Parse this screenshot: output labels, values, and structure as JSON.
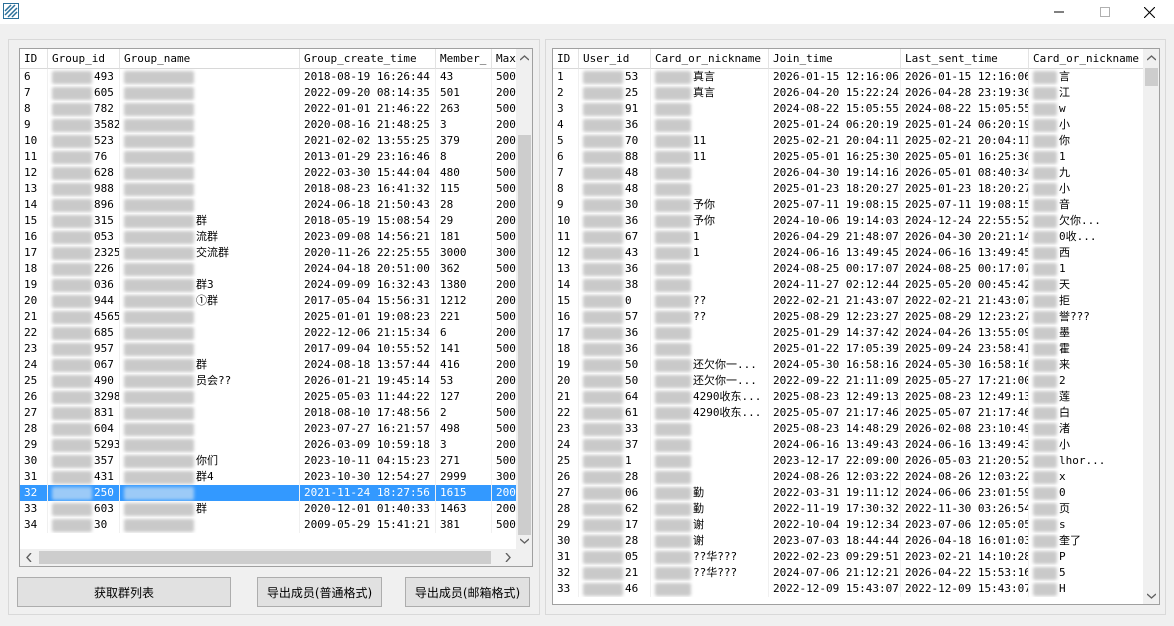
{
  "window": {
    "controls": [
      "minimize-icon",
      "maximize-icon",
      "close-icon"
    ]
  },
  "left_table": {
    "columns": [
      "ID",
      "Group_id",
      "Group_name",
      "Group_create_time",
      "Member_",
      "Max"
    ],
    "rows": [
      {
        "id": "6",
        "gid": "493",
        "name": "",
        "time": "2018-08-19 16:26:44",
        "member": "43",
        "max": "500"
      },
      {
        "id": "7",
        "gid": "605",
        "name": "",
        "time": "2022-09-20 08:14:35",
        "member": "501",
        "max": "200"
      },
      {
        "id": "8",
        "gid": "782",
        "name": "",
        "time": "2022-01-01 21:46:22",
        "member": "263",
        "max": "500"
      },
      {
        "id": "9",
        "gid": "3582",
        "name": "",
        "time": "2020-08-16 21:48:25",
        "member": "3",
        "max": "200"
      },
      {
        "id": "10",
        "gid": "523",
        "name": "",
        "time": "2021-02-02 13:55:25",
        "member": "379",
        "max": "200"
      },
      {
        "id": "11",
        "gid": "76",
        "name": "",
        "time": "2013-01-29 23:16:46",
        "member": "8",
        "max": "200"
      },
      {
        "id": "12",
        "gid": "628",
        "name": "",
        "time": "2022-03-30 15:44:04",
        "member": "480",
        "max": "500"
      },
      {
        "id": "13",
        "gid": "988",
        "name": "",
        "time": "2018-08-23 16:41:32",
        "member": "115",
        "max": "500"
      },
      {
        "id": "14",
        "gid": "896",
        "name": "",
        "time": "2024-06-18 21:50:43",
        "member": "28",
        "max": "200"
      },
      {
        "id": "15",
        "gid": "315",
        "name": "群",
        "time": "2018-05-19 15:08:54",
        "member": "29",
        "max": "200"
      },
      {
        "id": "16",
        "gid": "053",
        "name": "流群",
        "time": "2023-09-08 14:56:21",
        "member": "181",
        "max": "500"
      },
      {
        "id": "17",
        "gid": "2325",
        "name": "交流群",
        "time": "2020-11-26 22:25:55",
        "member": "3000",
        "max": "300"
      },
      {
        "id": "18",
        "gid": "226",
        "name": "",
        "time": "2024-04-18 20:51:00",
        "member": "362",
        "max": "500"
      },
      {
        "id": "19",
        "gid": "036",
        "name": "群3",
        "time": "2024-09-09 16:32:43",
        "member": "1380",
        "max": "200"
      },
      {
        "id": "20",
        "gid": "944",
        "name": "①群",
        "time": "2017-05-04 15:56:31",
        "member": "1212",
        "max": "200"
      },
      {
        "id": "21",
        "gid": "4565",
        "name": "",
        "time": "2025-01-01 19:08:23",
        "member": "221",
        "max": "500"
      },
      {
        "id": "22",
        "gid": "685",
        "name": "",
        "time": "2022-12-06 21:15:34",
        "member": "6",
        "max": "200"
      },
      {
        "id": "23",
        "gid": "957",
        "name": "",
        "time": "2017-09-04 10:55:52",
        "member": "141",
        "max": "500"
      },
      {
        "id": "24",
        "gid": "067",
        "name": "群",
        "time": "2024-08-18 13:57:44",
        "member": "416",
        "max": "200"
      },
      {
        "id": "25",
        "gid": "490",
        "name": "员会??",
        "time": "2026-01-21 19:45:14",
        "member": "53",
        "max": "200"
      },
      {
        "id": "26",
        "gid": "3298",
        "name": "",
        "time": "2025-05-03 11:44:22",
        "member": "127",
        "max": "200"
      },
      {
        "id": "27",
        "gid": "831",
        "name": "",
        "time": "2018-08-10 17:48:56",
        "member": "2",
        "max": "500"
      },
      {
        "id": "28",
        "gid": "604",
        "name": "",
        "time": "2023-07-27 16:21:57",
        "member": "498",
        "max": "500"
      },
      {
        "id": "29",
        "gid": "5293",
        "name": "",
        "time": "2026-03-09 10:59:18",
        "member": "3",
        "max": "200"
      },
      {
        "id": "30",
        "gid": "357",
        "name": "你们",
        "time": "2023-10-11 04:15:23",
        "member": "271",
        "max": "500"
      },
      {
        "id": "31",
        "gid": "431",
        "name": "群4",
        "time": "2023-10-30 12:54:27",
        "member": "2999",
        "max": "300"
      },
      {
        "id": "32",
        "gid": "250",
        "name": "",
        "time": "2021-11-24 18:27:56",
        "member": "1615",
        "max": "200"
      },
      {
        "id": "33",
        "gid": "603",
        "name": "群",
        "time": "2020-12-01 01:40:33",
        "member": "1463",
        "max": "200"
      },
      {
        "id": "34",
        "gid": "30",
        "name": "",
        "time": "2009-05-29 15:41:21",
        "member": "381",
        "max": "500"
      }
    ],
    "selected_id": "32"
  },
  "right_table": {
    "columns": [
      "ID",
      "User_id",
      "Card_or_nickname",
      "Join_time",
      "Last_sent_time",
      "Card_or_nickname"
    ],
    "rows": [
      {
        "id": "1",
        "uid": "53",
        "card": "真言",
        "join": "2026-01-15 12:16:06",
        "last": "2026-01-15 12:16:06",
        "card2": "言"
      },
      {
        "id": "2",
        "uid": "25",
        "card": "真言",
        "join": "2026-04-20 15:22:24",
        "last": "2026-04-28 23:19:30",
        "card2": "江"
      },
      {
        "id": "3",
        "uid": "91",
        "card": "",
        "join": "2024-08-22 15:05:55",
        "last": "2024-08-22 15:05:55",
        "card2": "w"
      },
      {
        "id": "4",
        "uid": "36",
        "card": "",
        "join": "2025-01-24 06:20:19",
        "last": "2025-01-24 06:20:19",
        "card2": "小"
      },
      {
        "id": "5",
        "uid": "70",
        "card": "11",
        "join": "2025-02-21 20:04:11",
        "last": "2025-02-21 20:04:11",
        "card2": "你"
      },
      {
        "id": "6",
        "uid": "88",
        "card": "11",
        "join": "2025-05-01 16:25:30",
        "last": "2025-05-01 16:25:30",
        "card2": "1"
      },
      {
        "id": "7",
        "uid": "48",
        "card": "",
        "join": "2026-04-30 19:14:16",
        "last": "2026-05-01 08:40:34",
        "card2": "九"
      },
      {
        "id": "8",
        "uid": "48",
        "card": "",
        "join": "2025-01-23 18:20:27",
        "last": "2025-01-23 18:20:27",
        "card2": "小"
      },
      {
        "id": "9",
        "uid": "30",
        "card": "予你",
        "join": "2025-07-11 19:08:15",
        "last": "2025-07-11 19:08:15",
        "card2": "音"
      },
      {
        "id": "10",
        "uid": "36",
        "card": "予你",
        "join": "2024-10-06 19:14:03",
        "last": "2024-12-24 22:55:52",
        "card2": "欠你..."
      },
      {
        "id": "11",
        "uid": "67",
        "card": "1",
        "join": "2026-04-29 21:48:07",
        "last": "2026-04-30 20:21:14",
        "card2": "0收..."
      },
      {
        "id": "12",
        "uid": "43",
        "card": "1",
        "join": "2024-06-16 13:49:45",
        "last": "2024-06-16 13:49:45",
        "card2": "西"
      },
      {
        "id": "13",
        "uid": "36",
        "card": "",
        "join": "2024-08-25 00:17:07",
        "last": "2024-08-25 00:17:07",
        "card2": "1"
      },
      {
        "id": "14",
        "uid": "38",
        "card": "",
        "join": "2024-11-27 02:12:44",
        "last": "2025-05-20 00:45:42",
        "card2": "天"
      },
      {
        "id": "15",
        "uid": "0",
        "card": "??",
        "join": "2022-02-21 21:43:07",
        "last": "2022-02-21 21:43:07",
        "card2": "拒"
      },
      {
        "id": "16",
        "uid": "57",
        "card": "??",
        "join": "2025-08-29 12:23:27",
        "last": "2025-08-29 12:23:27",
        "card2": "誉???"
      },
      {
        "id": "17",
        "uid": "36",
        "card": "",
        "join": "2025-01-29 14:37:42",
        "last": "2024-04-26 13:55:09",
        "card2": "墨"
      },
      {
        "id": "18",
        "uid": "36",
        "card": "",
        "join": "2025-01-22 17:05:39",
        "last": "2025-09-24 23:58:41",
        "card2": "霍"
      },
      {
        "id": "19",
        "uid": "50",
        "card": "还欠你一...",
        "join": "2024-05-30 16:58:16",
        "last": "2024-05-30 16:58:16",
        "card2": "来"
      },
      {
        "id": "20",
        "uid": "50",
        "card": "还欠你一...",
        "join": "2022-09-22 21:11:09",
        "last": "2025-05-27 17:21:00",
        "card2": "2"
      },
      {
        "id": "21",
        "uid": "64",
        "card": "4290收东...",
        "join": "2025-08-23 12:49:13",
        "last": "2025-08-23 12:49:13",
        "card2": "莲"
      },
      {
        "id": "22",
        "uid": "61",
        "card": "4290收东...",
        "join": "2025-05-07 21:17:46",
        "last": "2025-05-07 21:17:46",
        "card2": "白"
      },
      {
        "id": "23",
        "uid": "33",
        "card": "",
        "join": "2025-08-23 14:48:29",
        "last": "2026-02-08 23:10:49",
        "card2": "渚"
      },
      {
        "id": "24",
        "uid": "37",
        "card": "",
        "join": "2024-06-16 13:49:43",
        "last": "2024-06-16 13:49:43",
        "card2": "小"
      },
      {
        "id": "25",
        "uid": "1",
        "card": "",
        "join": "2023-12-17 22:09:00",
        "last": "2026-05-03 21:20:52",
        "card2": "lhor..."
      },
      {
        "id": "26",
        "uid": "28",
        "card": "",
        "join": "2024-08-26 12:03:22",
        "last": "2024-08-26 12:03:22",
        "card2": "x"
      },
      {
        "id": "27",
        "uid": "06",
        "card": "勤",
        "join": "2022-03-31 19:11:12",
        "last": "2024-06-06 23:01:59",
        "card2": "0"
      },
      {
        "id": "28",
        "uid": "62",
        "card": "勤",
        "join": "2022-11-19 17:30:32",
        "last": "2022-11-30 03:26:54",
        "card2": "页"
      },
      {
        "id": "29",
        "uid": "17",
        "card": "谢",
        "join": "2022-10-04 19:12:34",
        "last": "2023-07-06 12:05:05",
        "card2": "s"
      },
      {
        "id": "30",
        "uid": "28",
        "card": "谢",
        "join": "2023-07-03 18:44:44",
        "last": "2026-04-18 16:01:03",
        "card2": "奎了"
      },
      {
        "id": "31",
        "uid": "05",
        "card": "??华???",
        "join": "2022-02-23 09:29:51",
        "last": "2023-02-21 14:10:28",
        "card2": "P"
      },
      {
        "id": "32",
        "uid": "21",
        "card": "??华???",
        "join": "2024-07-06 21:12:21",
        "last": "2026-04-22 15:53:16",
        "card2": "5"
      },
      {
        "id": "33",
        "uid": "46",
        "card": "",
        "join": "2022-12-09 15:43:07",
        "last": "2022-12-09 15:43:07",
        "card2": "H"
      }
    ]
  },
  "buttons": {
    "get_groups": "获取群列表",
    "export_normal": "导出成员(普通格式)",
    "export_email": "导出成员(邮箱格式)"
  }
}
